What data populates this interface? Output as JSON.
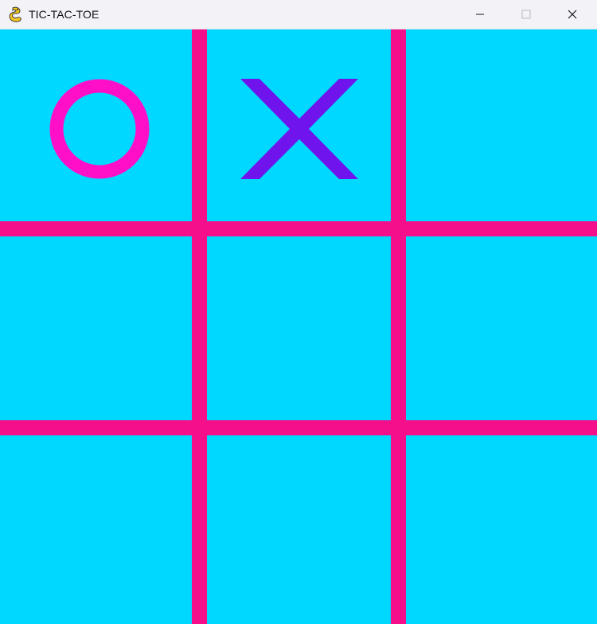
{
  "window": {
    "title": "TIC-TAC-TOE",
    "app_icon": "pygame-snake-icon",
    "controls": {
      "minimize_icon": "minimize-icon",
      "maximize_icon": "maximize-icon",
      "close_icon": "close-icon"
    }
  },
  "board": {
    "rows": 3,
    "cols": 3,
    "cells": [
      [
        "O",
        "X",
        ""
      ],
      [
        "",
        "",
        ""
      ],
      [
        "",
        "",
        ""
      ]
    ]
  },
  "colors": {
    "background": "#00d8ff",
    "grid_lines": "#f50f8a",
    "o_mark": "#ff10c8",
    "x_mark": "#7014ee",
    "titlebar": "#f3f2f7"
  }
}
